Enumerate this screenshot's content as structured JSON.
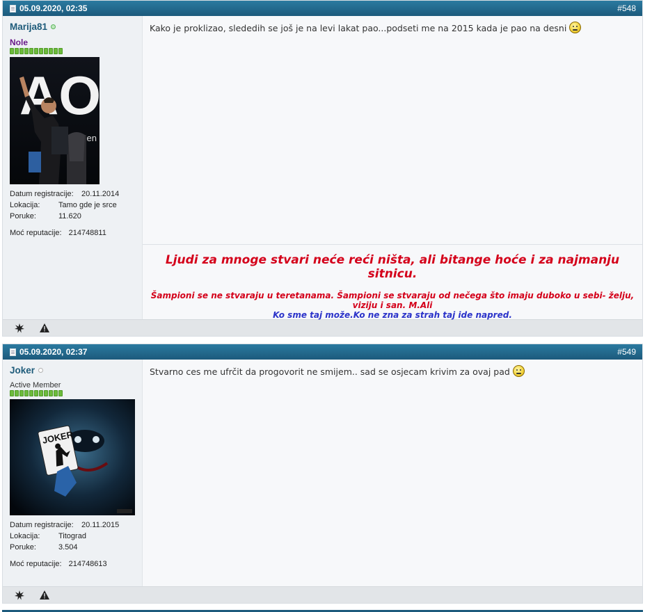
{
  "posts": [
    {
      "date": "05.09.2020, 02:35",
      "number": "#548",
      "username": "Marija81",
      "user_status": "online",
      "user_title": "Nole",
      "reg_label": "Datum registracije:",
      "reg_value": "20.11.2014",
      "loc_label": "Lokacija:",
      "loc_value": "Tamo gde je srce",
      "posts_label": "Poruke:",
      "posts_value": "11.620",
      "rep_label": "Moć reputacije:",
      "rep_value": "214748811",
      "avatar_text": "AO",
      "avatar_subtext": "open",
      "message": "Kako je proklizao, slededih se još je na levi lakat pao...podseti me na 2015 kada je pao na desni",
      "signature": {
        "line1": "Ljudi za mnoge stvari neće reći ništa, ali bitange hoće i za najmanju sitnicu.",
        "line2": "Šampioni se ne stvaraju u teretanama. Šampioni se stvaraju od nečega što imaju duboko u sebi- želju, viziju i san. M.Ali",
        "line3": "Ko sme taj može.Ko ne zna za strah taj ide napred."
      }
    },
    {
      "date": "05.09.2020, 02:37",
      "number": "#549",
      "username": "Joker",
      "user_status": "offline",
      "user_title": "Active Member",
      "reg_label": "Datum registracije:",
      "reg_value": "20.11.2015",
      "loc_label": "Lokacija:",
      "loc_value": "Titograd",
      "posts_label": "Poruke:",
      "posts_value": "3.504",
      "rep_label": "Moć reputacije:",
      "rep_value": "214748613",
      "avatar_text": "JOKER",
      "message": "Stvarno ces me ufrčit da progovorit ne smijem.. sad se osjecam krivim za ovaj pad"
    }
  ],
  "icons": {
    "footer": [
      "star-icon",
      "warning-icon"
    ],
    "post": "document-icon",
    "smiley": "smiley-icon"
  },
  "colors": {
    "header": "#1c5a7c",
    "username": "#1e5b7a",
    "nole_title": "#6a1b8a",
    "rep_green": "#6dbb3c",
    "sig_red": "#d4001a",
    "sig_blue": "#2b33c9"
  }
}
